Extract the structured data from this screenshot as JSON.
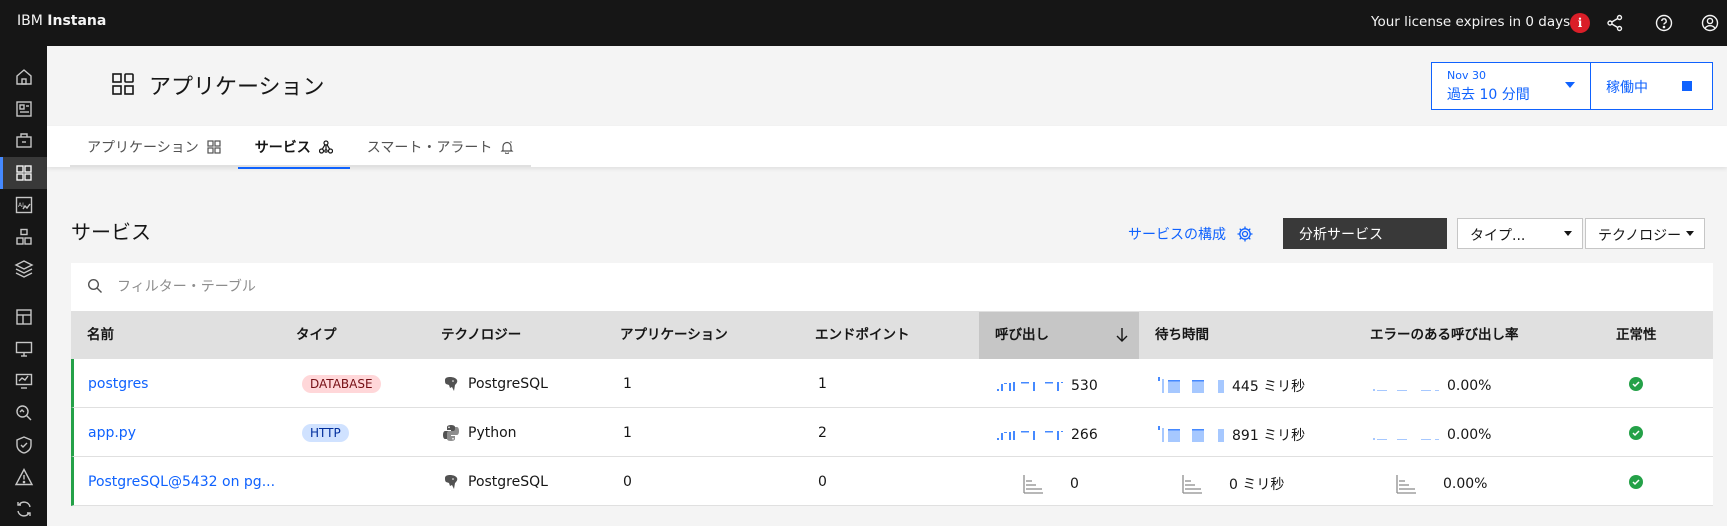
{
  "topbar": {
    "brand_prefix": "IBM",
    "brand_name": "Instana",
    "license_text": "Your license expires in 0 days"
  },
  "header": {
    "title": "アプリケーション",
    "time_date": "Nov 30",
    "time_range": "過去 10 分間",
    "live_label": "稼働中"
  },
  "tabs": [
    {
      "label": "アプリケーション"
    },
    {
      "label": "サービス"
    },
    {
      "label": "スマート・アラート"
    }
  ],
  "section": {
    "title": "サービス",
    "config_link": "サービスの構成",
    "analyze_button": "分析サービス",
    "type_dropdown": "タイプ...",
    "tech_dropdown": "テクノロジー"
  },
  "search": {
    "placeholder": "フィルター・テーブル"
  },
  "table": {
    "columns": [
      "名前",
      "タイプ",
      "テクノロジー",
      "アプリケーション",
      "エンドポイント",
      "呼び出し",
      "待ち時間",
      "エラーのある呼び出し率",
      "正常性"
    ],
    "rows": [
      {
        "name": "postgres",
        "type": "DATABASE",
        "technology": "PostgreSQL",
        "applications": "1",
        "endpoints": "1",
        "calls": "530",
        "latency": "445 ミリ秒",
        "error_rate": "0.00%"
      },
      {
        "name": "app.py",
        "type": "HTTP",
        "technology": "Python",
        "applications": "1",
        "endpoints": "2",
        "calls": "266",
        "latency": "891 ミリ秒",
        "error_rate": "0.00%"
      },
      {
        "name": "PostgreSQL@5432 on pg...",
        "type": "",
        "technology": "PostgreSQL",
        "applications": "0",
        "endpoints": "0",
        "calls": "0",
        "latency": "0 ミリ秒",
        "error_rate": "0.00%"
      }
    ]
  },
  "colors": {
    "accent": "#0f62fe",
    "healthy": "#24a148",
    "dark": "#161616"
  }
}
